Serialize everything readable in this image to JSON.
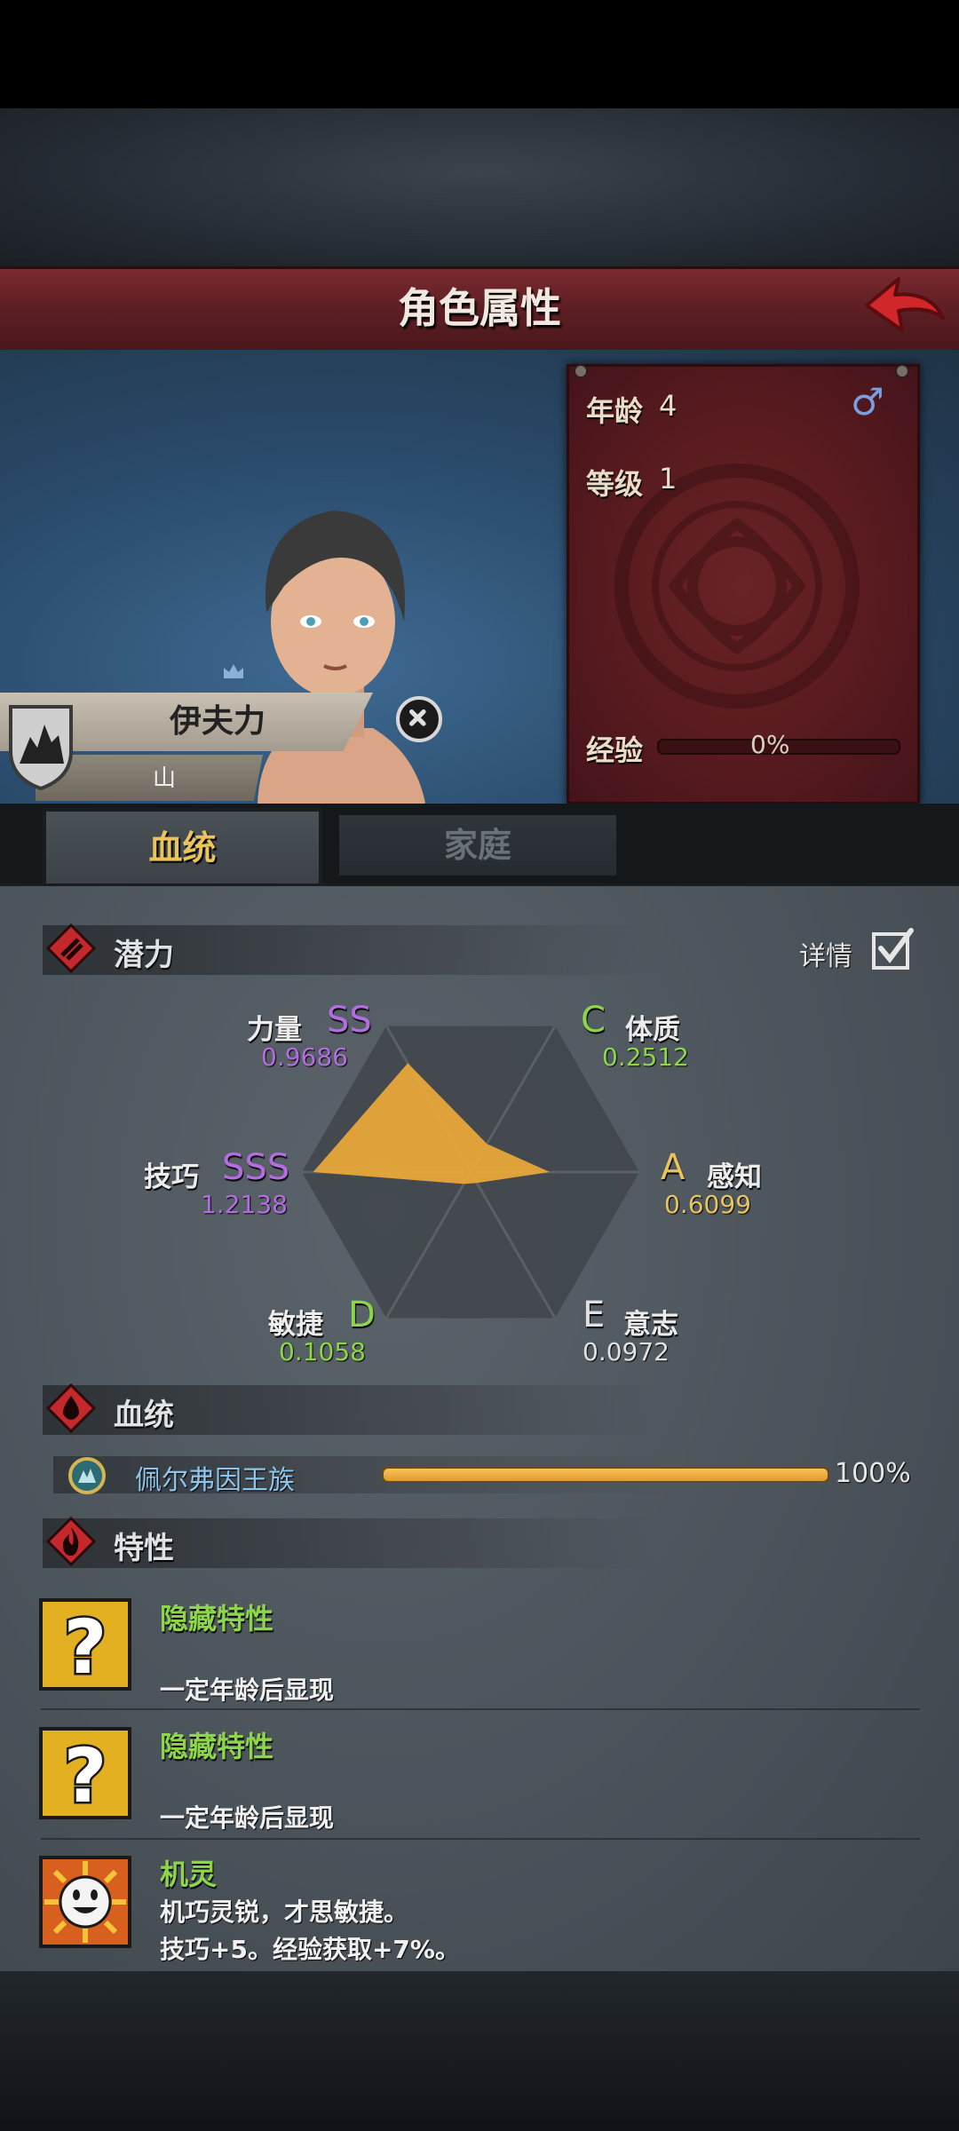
{
  "header": {
    "title": "角色属性"
  },
  "info": {
    "age_label": "年龄",
    "age_value": "4",
    "gender_symbol": "♂",
    "level_label": "等级",
    "level_value": "1",
    "exp_label": "经验",
    "exp_percent": "0%"
  },
  "character": {
    "name": "伊夫力",
    "subtitle": "山"
  },
  "tabs": [
    {
      "label": "血统",
      "active": true
    },
    {
      "label": "家庭",
      "active": false
    }
  ],
  "potential": {
    "title": "潜力",
    "detail_label": "详情",
    "detail_checked": true,
    "stats": [
      {
        "name": "力量",
        "grade": "SS",
        "value": "0.9686",
        "color": "#b46de0"
      },
      {
        "name": "体质",
        "grade": "C",
        "value": "0.2512",
        "color": "#8dd64a"
      },
      {
        "name": "感知",
        "grade": "A",
        "value": "0.6099",
        "color": "#e8c45a"
      },
      {
        "name": "意志",
        "grade": "E",
        "value": "0.0972",
        "color": "#e0e0e0"
      },
      {
        "name": "敏捷",
        "grade": "D",
        "value": "0.1058",
        "color": "#8dd64a"
      },
      {
        "name": "技巧",
        "grade": "SSS",
        "value": "1.2138",
        "color": "#b46de0"
      }
    ]
  },
  "lineage": {
    "title": "血统",
    "items": [
      {
        "name": "佩尔弗因王族",
        "percent": "100%",
        "fraction": 1.0
      }
    ]
  },
  "traits": {
    "title": "特性",
    "items": [
      {
        "icon": "question-mark-icon",
        "name": "隐藏特性",
        "desc1": "一定年龄后显现",
        "desc2": ""
      },
      {
        "icon": "question-mark-icon",
        "name": "隐藏特性",
        "desc1": "一定年龄后显现",
        "desc2": ""
      },
      {
        "icon": "smiley-face-icon",
        "name": "机灵",
        "desc1": "机巧灵锐，才思敏捷。",
        "desc2": "技巧+5。经验获取+7%。"
      }
    ]
  },
  "colors": {
    "header_red": "#6a2328",
    "radar_fill": "#e8a83a",
    "trait_name_green": "#8dd64a",
    "lineage_blue": "#8ec5ea"
  }
}
